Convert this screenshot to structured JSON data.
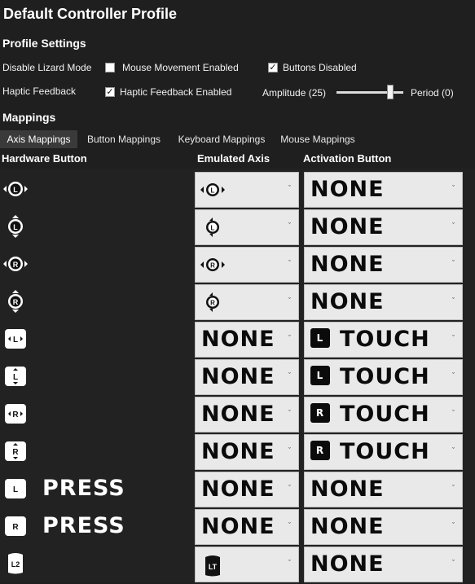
{
  "title": "Default Controller Profile",
  "profile_settings": {
    "heading": "Profile Settings",
    "disable_lizard_label": "Disable Lizard Mode",
    "mouse_movement_label": "Mouse Movement Enabled",
    "mouse_movement_checked": false,
    "buttons_disabled_label": "Buttons Disabled",
    "buttons_disabled_checked": true,
    "haptic_label": "Haptic Feedback",
    "haptic_enabled_label": "Haptic Feedback Enabled",
    "haptic_enabled_checked": true,
    "amplitude_label": "Amplitude (25)",
    "amplitude_value": 25,
    "period_label": "Period (0)"
  },
  "mappings": {
    "heading": "Mappings",
    "tabs": [
      "Axis Mappings",
      "Button Mappings",
      "Keyboard Mappings",
      "Mouse Mappings"
    ],
    "active_tab": 0,
    "columns": [
      "Hardware Button",
      "Emulated Axis",
      "Activation Button"
    ],
    "rows": [
      {
        "hw_icon": "left-stick-horizontal-icon",
        "hw_text": "",
        "axis": "",
        "axis_icon": "left-stick-horizontal-icon",
        "act": "NONE",
        "act_badge": ""
      },
      {
        "hw_icon": "left-stick-vertical-icon",
        "hw_text": "",
        "axis": "",
        "axis_icon": "left-stick-vertical-icon",
        "act": "NONE",
        "act_badge": ""
      },
      {
        "hw_icon": "right-stick-horizontal-icon",
        "hw_text": "",
        "axis": "",
        "axis_icon": "right-stick-horizontal-icon",
        "act": "NONE",
        "act_badge": ""
      },
      {
        "hw_icon": "right-stick-vertical-icon",
        "hw_text": "",
        "axis": "",
        "axis_icon": "right-stick-vertical-icon",
        "act": "NONE",
        "act_badge": ""
      },
      {
        "hw_icon": "left-pad-horizontal-icon",
        "hw_text": "",
        "axis": "NONE",
        "axis_icon": "",
        "act": "TOUCH",
        "act_badge": "L"
      },
      {
        "hw_icon": "left-pad-vertical-icon",
        "hw_text": "",
        "axis": "NONE",
        "axis_icon": "",
        "act": "TOUCH",
        "act_badge": "L"
      },
      {
        "hw_icon": "right-pad-horizontal-icon",
        "hw_text": "",
        "axis": "NONE",
        "axis_icon": "",
        "act": "TOUCH",
        "act_badge": "R"
      },
      {
        "hw_icon": "right-pad-vertical-icon",
        "hw_text": "",
        "axis": "NONE",
        "axis_icon": "",
        "act": "TOUCH",
        "act_badge": "R"
      },
      {
        "hw_icon": "left-pad-press-icon",
        "hw_text": "PRESS",
        "axis": "NONE",
        "axis_icon": "",
        "act": "NONE",
        "act_badge": ""
      },
      {
        "hw_icon": "right-pad-press-icon",
        "hw_text": "PRESS",
        "axis": "NONE",
        "axis_icon": "",
        "act": "NONE",
        "act_badge": ""
      },
      {
        "hw_icon": "left-trigger-icon",
        "hw_text": "",
        "axis": "",
        "axis_icon": "left-trigger-lt-icon",
        "act": "NONE",
        "act_badge": ""
      }
    ],
    "badge_labels": {
      "L": "L",
      "R": "R",
      "L2": "L2",
      "LT": "LT",
      "stickL": "L",
      "stickR": "R"
    }
  }
}
